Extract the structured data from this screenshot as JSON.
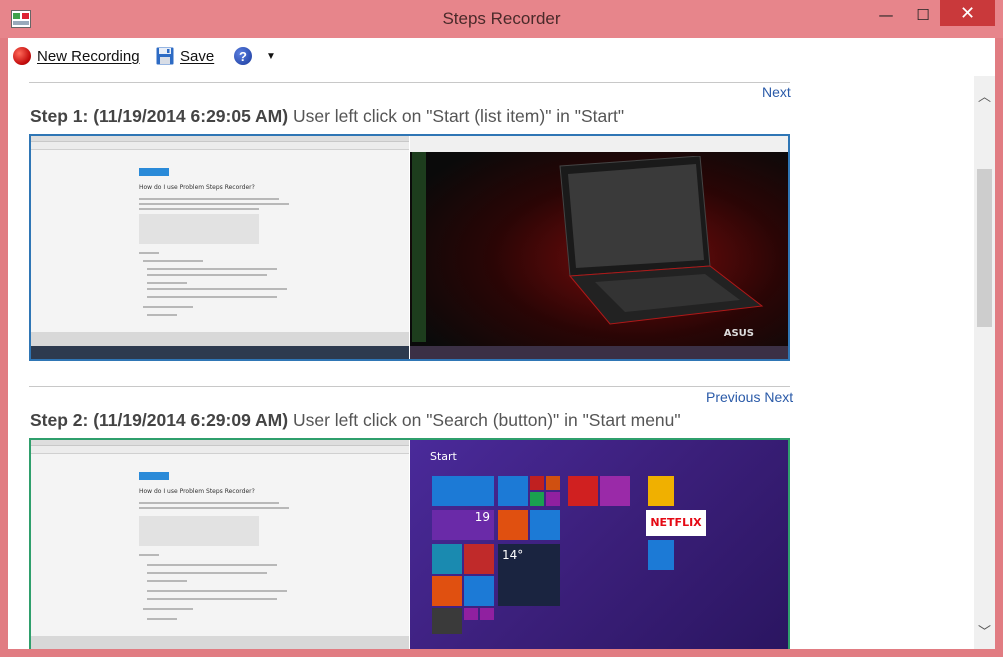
{
  "window": {
    "title": "Steps Recorder",
    "controls": {
      "minimize": "—",
      "maximize": "☐",
      "close": "✕"
    }
  },
  "toolbar": {
    "new_recording": "New Recording",
    "save": "Save",
    "help": "?"
  },
  "steps": [
    {
      "nav": [
        "Next"
      ],
      "number_label": "Step 1: (11/19/2014 6:29:05 AM)",
      "description": "User left click on \"Start (list item)\" in \"Start\""
    },
    {
      "nav": [
        "Previous",
        "Next"
      ],
      "number_label": "Step 2: (11/19/2014 6:29:09 AM)",
      "description": "User left click on \"Search (button)\" in \"Start menu\""
    }
  ],
  "screenshots": {
    "doc_title": "How do I use Problem Steps Recorder?",
    "brand": "ASUS",
    "netflix": "NETFLIX",
    "start_label": "Start",
    "weather_temp": "14°",
    "calendar_day": "19"
  },
  "colors": {
    "titlebar": "#e7858b",
    "close": "#c9393b",
    "link": "#2a5aa8",
    "shot_border": "#2f76b5",
    "start_bg": "#3b1f7a"
  },
  "icons": {
    "record": "record-icon",
    "save": "floppy-disk-icon",
    "help": "help-icon"
  }
}
